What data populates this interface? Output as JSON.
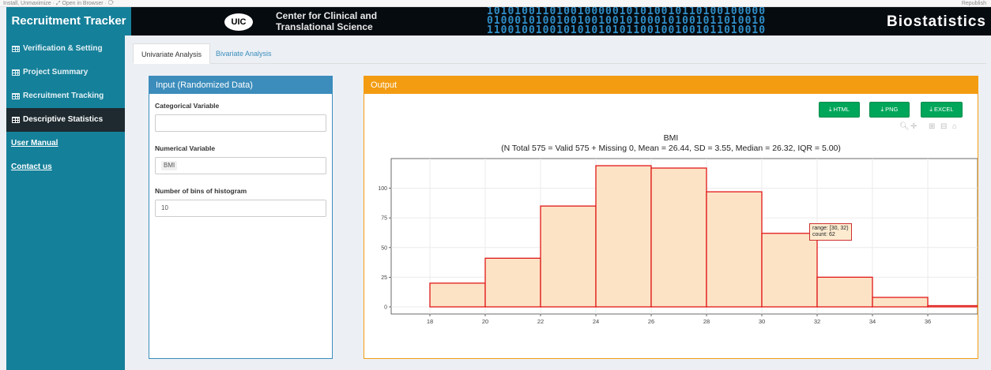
{
  "topbar": {
    "text": "Install, Unmaximize · ⤢ Open in Browser · ⟳",
    "right": "Republish"
  },
  "header": {
    "brand": "Recruitment Tracker",
    "uic_logo": "UIC",
    "center_line1": "Center for Clinical and",
    "center_line2": "Translational Science",
    "biostat": "Biostatistics",
    "binary_rows": [
      "1010100110100100000101010010110100100000",
      "0100010100100100100101000101001011010010",
      "1100100100101010101011001001001011010010"
    ]
  },
  "sidebar": {
    "items": [
      {
        "label": "Verification & Setting",
        "icon": "table-icon",
        "active": false
      },
      {
        "label": "Project Summary",
        "icon": "table-icon",
        "active": false
      },
      {
        "label": "Recruitment Tracking",
        "icon": "table-icon",
        "active": false
      },
      {
        "label": "Descriptive Statistics",
        "icon": "table-icon",
        "active": true
      }
    ],
    "links": [
      "User Manual",
      "Contact us"
    ]
  },
  "tabs": [
    {
      "label": "Univariate Analysis",
      "active": true
    },
    {
      "label": "Bivariate Analysis",
      "active": false
    }
  ],
  "input_panel": {
    "title": "Input (Randomized Data)",
    "categorical_label": "Categorical Variable",
    "categorical_value": "",
    "numerical_label": "Numerical Variable",
    "numerical_value": "BMI",
    "bins_label": "Number of bins of histogram",
    "bins_value": "10"
  },
  "output_panel": {
    "title": "Output",
    "buttons": [
      {
        "label": "HTML",
        "icon": "download-icon"
      },
      {
        "label": "PNG",
        "icon": "download-icon"
      },
      {
        "label": "EXCEL",
        "icon": "download-icon"
      }
    ],
    "modebar_icons": [
      "zoom-icon",
      "pan-icon",
      "zoom-in-icon",
      "zoom-out-icon",
      "home-icon"
    ],
    "tooltip_range": "range: [30, 32)",
    "tooltip_count": "count:  62"
  },
  "colors": {
    "sidebar": "#15809a",
    "input_header": "#3c8dbc",
    "output_header": "#f39c12",
    "button": "#00a65a",
    "bar_fill": "#fde3c6",
    "bar_stroke": "#e01818"
  },
  "chart_data": {
    "type": "bar",
    "title": "BMI",
    "subtitle": "(N Total 575 = Valid 575 + Missing 0, Mean = 26.44, SD = 3.55, Median = 26.32, IQR = 5.00)",
    "bins": [
      {
        "range": [
          18,
          20
        ],
        "count": 20
      },
      {
        "range": [
          20,
          22
        ],
        "count": 41
      },
      {
        "range": [
          22,
          24
        ],
        "count": 85
      },
      {
        "range": [
          24,
          26
        ],
        "count": 119
      },
      {
        "range": [
          26,
          28
        ],
        "count": 117
      },
      {
        "range": [
          28,
          30
        ],
        "count": 97
      },
      {
        "range": [
          30,
          32
        ],
        "count": 62
      },
      {
        "range": [
          32,
          34
        ],
        "count": 25
      },
      {
        "range": [
          34,
          36
        ],
        "count": 8
      },
      {
        "range": [
          36,
          38
        ],
        "count": 1
      }
    ],
    "x_ticks": [
      18,
      20,
      22,
      24,
      26,
      28,
      30,
      32,
      34,
      36
    ],
    "y_ticks": [
      0,
      25,
      50,
      75,
      100
    ],
    "xlim": [
      16.6,
      37.8
    ],
    "ylim": [
      -6,
      125
    ],
    "grid": true,
    "xlabel": "",
    "ylabel": ""
  }
}
